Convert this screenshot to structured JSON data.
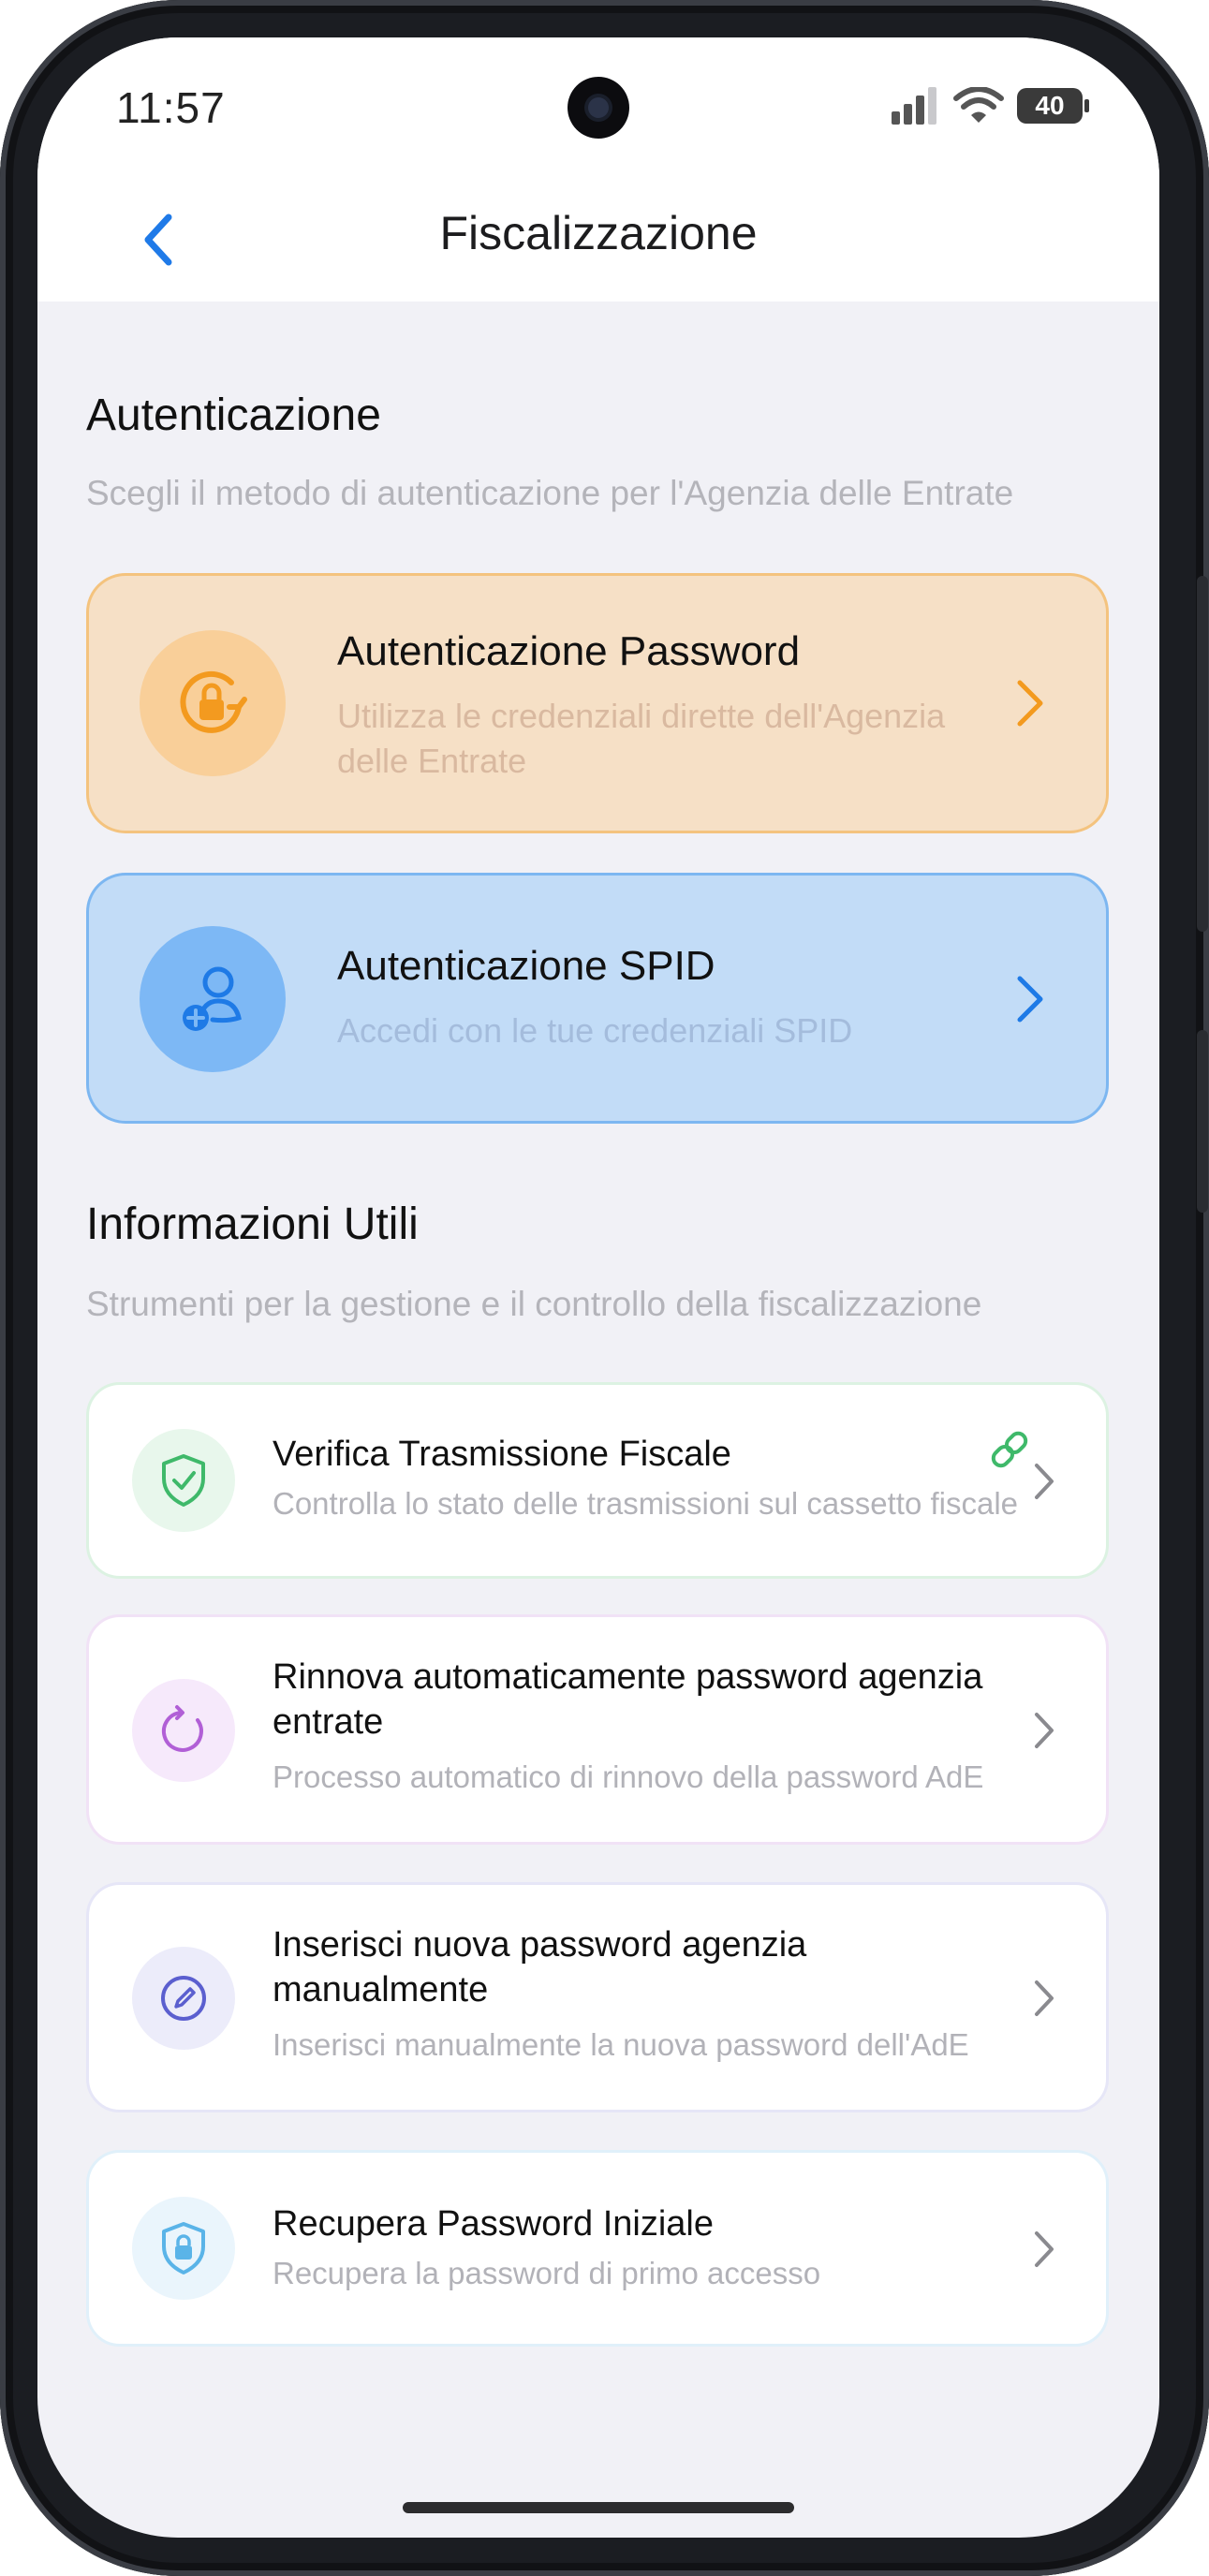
{
  "status_bar": {
    "time": "11:57",
    "battery": "40"
  },
  "header": {
    "back_icon": "chevron-left-icon",
    "title": "Fiscalizzazione"
  },
  "authentication": {
    "title": "Autenticazione",
    "subtitle": "Scegli il metodo di autenticazione per l'Agenzia delle Entrate",
    "options": [
      {
        "title": "Autenticazione Password",
        "description": "Utilizza le credenziali dirette dell'Agenzia delle Entrate",
        "icon": "lock-rotate-icon",
        "accent": "#f39a1f"
      },
      {
        "title": "Autenticazione SPID",
        "description": "Accedi con le tue credenziali SPID",
        "icon": "user-add-icon",
        "accent": "#1e7ae6"
      }
    ]
  },
  "info": {
    "title": "Informazioni Utili",
    "subtitle": "Strumenti per la gestione e il controllo della fiscalizzazione",
    "items": [
      {
        "title": "Verifica Trasmissione Fiscale",
        "description": "Controlla lo stato delle trasmissioni sul cassetto fiscale",
        "icon": "shield-check-icon",
        "extra_icon": "link-icon",
        "accent": "#3fb96a"
      },
      {
        "title": "Rinnova automaticamente password agenzia entrate",
        "description": "Processo automatico di rinnovo della password AdE",
        "icon": "refresh-icon",
        "accent": "#b15fd6"
      },
      {
        "title": "Inserisci nuova password agenzia manualmente",
        "description": "Inserisci manualmente la nuova password dell'AdE",
        "icon": "edit-icon",
        "accent": "#5b5fcf"
      },
      {
        "title": "Recupera Password Iniziale",
        "description": "Recupera la password di primo accesso",
        "icon": "lock-shield-icon",
        "accent": "#5ab4e8"
      }
    ]
  }
}
